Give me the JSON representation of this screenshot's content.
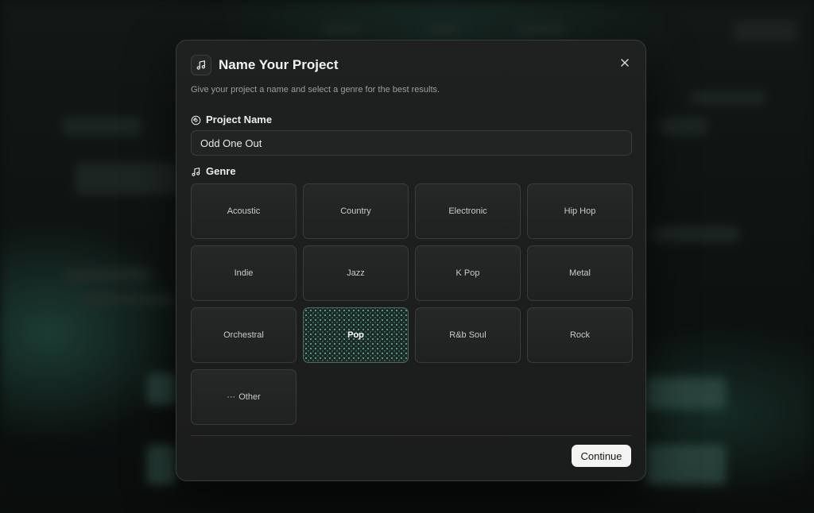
{
  "modal": {
    "title": "Name Your Project",
    "subtitle": "Give your project a name and select a genre for the best results.",
    "header_icon": "music-note-icon",
    "close_icon": "close-icon"
  },
  "project_name": {
    "label": "Project Name",
    "icon": "vinyl-record-icon",
    "value": "Odd One Out"
  },
  "genre": {
    "label": "Genre",
    "icon": "music-note-icon",
    "selected": "Pop",
    "options": [
      {
        "label": "Acoustic"
      },
      {
        "label": "Country"
      },
      {
        "label": "Electronic"
      },
      {
        "label": "Hip Hop"
      },
      {
        "label": "Indie"
      },
      {
        "label": "Jazz"
      },
      {
        "label": "K Pop"
      },
      {
        "label": "Metal"
      },
      {
        "label": "Orchestral"
      },
      {
        "label": "Pop"
      },
      {
        "label": "R&b Soul"
      },
      {
        "label": "Rock"
      },
      {
        "label": "Other",
        "icon": "ellipsis-icon",
        "prefix": "···"
      }
    ]
  },
  "footer": {
    "continue_label": "Continue"
  },
  "colors": {
    "modal_background": "#1f2121",
    "accent_teal": "#4d6b63",
    "button_background": "#f4f4f3"
  }
}
